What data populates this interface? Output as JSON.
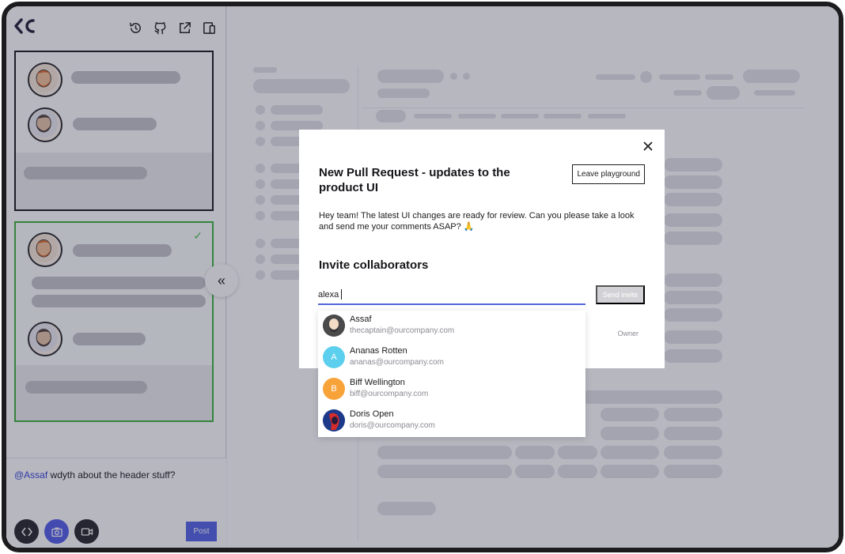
{
  "comment": {
    "mention": "@Assaf",
    "text": " wdyth about the header stuff?",
    "post_label": "Post"
  },
  "modal": {
    "title": "New Pull Request - updates to the product UI",
    "leave_label": "Leave playground",
    "description": "Hey team! The latest UI changes are ready for review. Can you please take a look and send me your comments ASAP? 🙏",
    "invite_title": "Invite collaborators",
    "invite_value": "alexa",
    "send_label": "Send invite",
    "owner_label": "Owner"
  },
  "suggestions": [
    {
      "name": "Assaf",
      "email": "thecaptain@ourcompany.com",
      "initial": "",
      "color": "#3a3a3a"
    },
    {
      "name": "Ananas Rotten",
      "email": "ananas@ourcompany.com",
      "initial": "A",
      "color": "#5ccfee"
    },
    {
      "name": "Biff Wellington",
      "email": "biff@ourcompany.com",
      "initial": "B",
      "color": "#f7a33a"
    },
    {
      "name": "Doris Open",
      "email": "doris@ourcompany.com",
      "initial": "",
      "color": "#1d3a8a"
    }
  ],
  "colors": {
    "accent": "#5465e6",
    "card_active_border": "#3fb43f",
    "overlay": "#1e1e3c"
  },
  "icons": [
    "logo-icon",
    "history-icon",
    "github-icon",
    "external-link-icon",
    "device-preview-icon",
    "check-icon",
    "collapse-icon",
    "code-icon",
    "camera-icon",
    "video-icon",
    "close-icon"
  ]
}
